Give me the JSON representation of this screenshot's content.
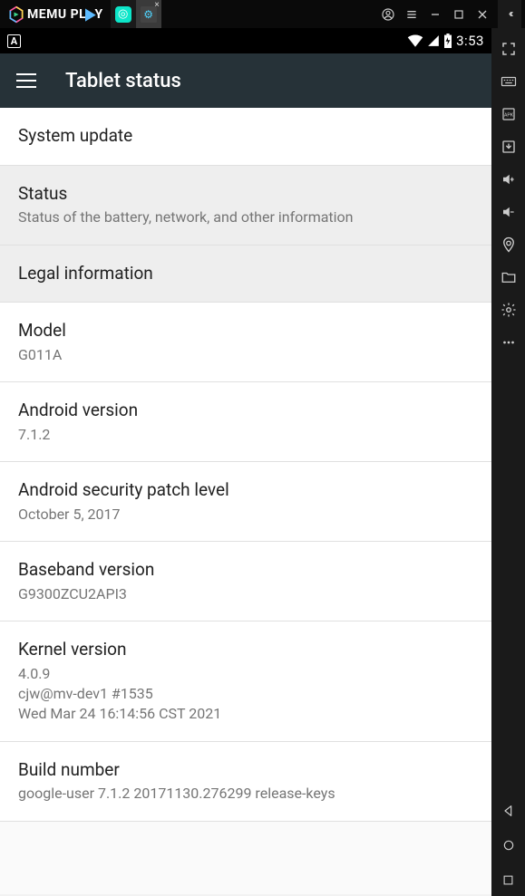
{
  "titlebar": {
    "brand_prefix": "MEMU PL",
    "brand_suffix": "Y"
  },
  "statusbar": {
    "indicator": "A",
    "time": "3:53"
  },
  "appbar": {
    "title": "Tablet status"
  },
  "settings": [
    {
      "title": "System update",
      "sub": null,
      "shaded": false
    },
    {
      "title": "Status",
      "sub": "Status of the battery, network, and other information",
      "shaded": true
    },
    {
      "title": "Legal information",
      "sub": null,
      "shaded": true
    },
    {
      "title": "Model",
      "sub": "G011A",
      "shaded": false
    },
    {
      "title": "Android version",
      "sub": "7.1.2",
      "shaded": false
    },
    {
      "title": "Android security patch level",
      "sub": "October 5, 2017",
      "shaded": false
    },
    {
      "title": "Baseband version",
      "sub": "G9300ZCU2API3",
      "shaded": false
    },
    {
      "title": "Kernel version",
      "sub": "4.0.9\ncjw@mv-dev1 #1535\nWed Mar 24 16:14:56 CST 2021",
      "shaded": false
    },
    {
      "title": "Build number",
      "sub": "google-user 7.1.2 20171130.276299 release-keys",
      "shaded": false
    }
  ]
}
